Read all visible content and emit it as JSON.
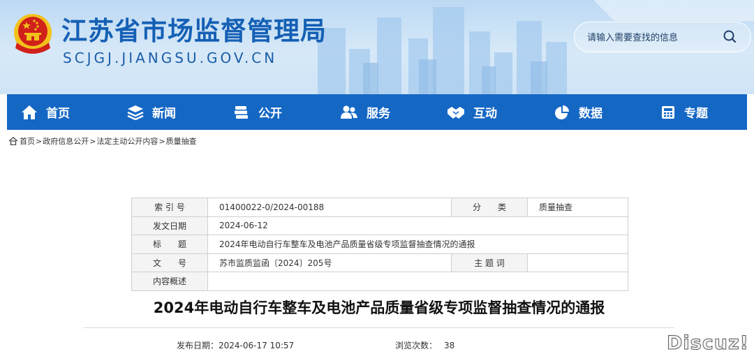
{
  "header": {
    "site_title": "江苏省市场监督管理局",
    "site_domain": "SCJGJ.JIANGSU.GOV.CN",
    "emblem_icon": "national-emblem-icon",
    "search_placeholder": "请输入需要查找的信息",
    "search_icon": "search-icon"
  },
  "nav": {
    "items": [
      {
        "label": "首页",
        "icon": "home-icon"
      },
      {
        "label": "新闻",
        "icon": "layers-icon"
      },
      {
        "label": "公开",
        "icon": "books-icon"
      },
      {
        "label": "服务",
        "icon": "users-icon"
      },
      {
        "label": "互动",
        "icon": "handshake-icon"
      },
      {
        "label": "数据",
        "icon": "pie-chart-icon"
      },
      {
        "label": "专题",
        "icon": "calculator-icon"
      }
    ]
  },
  "breadcrumb": {
    "items": [
      "首页",
      "政府信息公开",
      "法定主动公开内容",
      "质量抽查"
    ],
    "separator": ">"
  },
  "meta_table": {
    "index_label": "索 引 号",
    "index_value": "01400022-0/2024-00188",
    "category_label": "分　　类",
    "category_value": "质量抽查",
    "date_label": "发文日期",
    "date_value": "2024-06-12",
    "title_label": "标　　题",
    "title_value": "2024年电动自行车整车及电池产品质量省级专项监督抽查情况的通报",
    "docno_label": "文　　号",
    "docno_value": "苏市监质监函〔2024〕205号",
    "keywords_label": "主 题 词",
    "keywords_value": "",
    "summary_label": "内容概述",
    "summary_value": ""
  },
  "article": {
    "title": "2024年电动自行车整车及电池产品质量省级专项监督抽查情况的通报",
    "publish_label": "发布日期：",
    "publish_value": "2024-06-17 10:57",
    "views_label": "浏览次数：",
    "views_value": "38"
  },
  "watermark": "Discuz!",
  "colors": {
    "nav_bg": "#1567c4",
    "title_blue": "#1560b5",
    "header_bg": "#c6dff5",
    "emblem_red": "#d0211b",
    "emblem_gold": "#f2c21b"
  }
}
